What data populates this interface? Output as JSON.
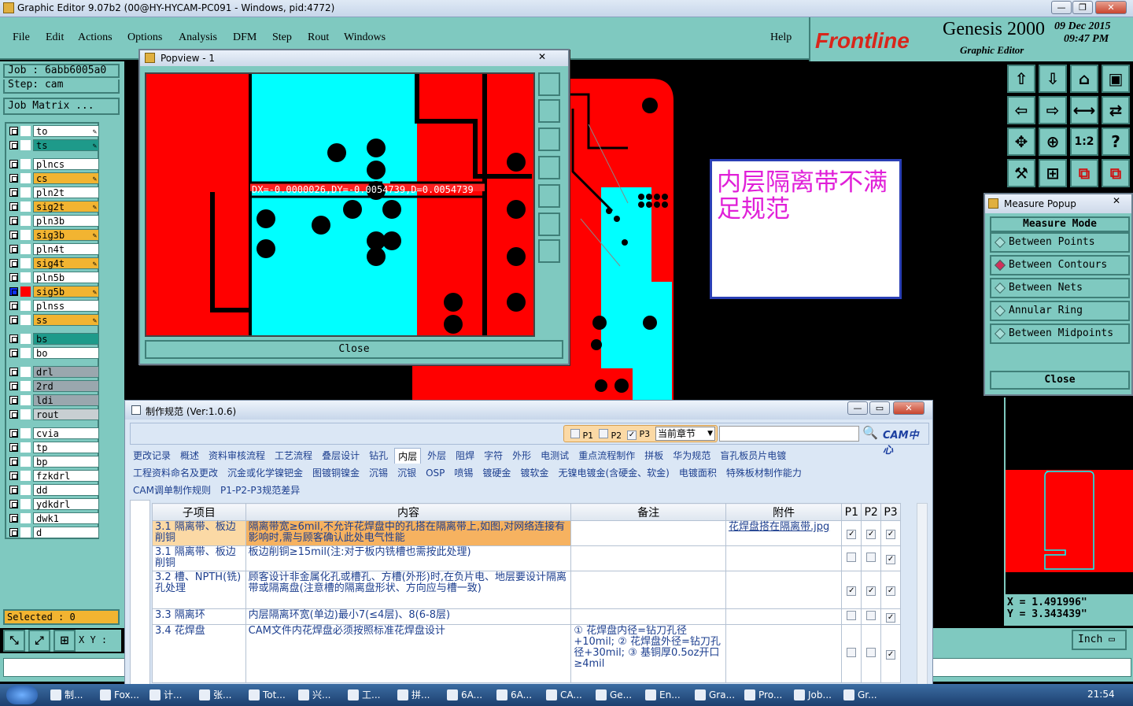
{
  "window": {
    "title": "Graphic Editor 9.07b2 (00@HY-HYCAM-PC091 - Windows, pid:4772)"
  },
  "menu": {
    "items": [
      "File",
      "Edit",
      "Actions",
      "Options",
      "Analysis",
      "DFM",
      "Step",
      "Rout",
      "Windows"
    ],
    "help": "Help"
  },
  "brand": {
    "logo": "Frontline",
    "product": "Genesis 2000",
    "subtitle": "Graphic Editor",
    "date": "09 Dec 2015",
    "time": "09:47 PM"
  },
  "job": {
    "job_label": "Job : 6abb6005a0",
    "step_label": "Step: cam",
    "matrix_button": "Job Matrix ..."
  },
  "layers": [
    {
      "name": "to",
      "color": "#ffffff",
      "pen": true
    },
    {
      "name": "ts",
      "color": "#1e9a8a",
      "pen": true
    },
    {
      "name": "plncs",
      "color": "#ffffff",
      "pen": false
    },
    {
      "name": "cs",
      "color": "#f2b431",
      "pen": true
    },
    {
      "name": "pln2t",
      "color": "#ffffff",
      "pen": false
    },
    {
      "name": "sig2t",
      "color": "#f2b431",
      "pen": true
    },
    {
      "name": "pln3b",
      "color": "#ffffff",
      "pen": false
    },
    {
      "name": "sig3b",
      "color": "#f2b431",
      "pen": true
    },
    {
      "name": "pln4t",
      "color": "#ffffff",
      "pen": false
    },
    {
      "name": "sig4t",
      "color": "#f2b431",
      "pen": true
    },
    {
      "name": "pln5b",
      "color": "#ffffff",
      "pen": false
    },
    {
      "name": "sig5b",
      "color": "#f2b431",
      "pen": true
    },
    {
      "name": "plnss",
      "color": "#ffffff",
      "pen": false
    },
    {
      "name": "ss",
      "color": "#f2b431",
      "pen": true
    },
    {
      "name": "bs",
      "color": "#1e9a8a",
      "pen": false
    },
    {
      "name": "bo",
      "color": "#ffffff",
      "pen": false
    },
    {
      "name": "drl",
      "color": "#9aa7ae",
      "pen": false
    },
    {
      "name": "2rd",
      "color": "#9aa7ae",
      "pen": false
    },
    {
      "name": "ldi",
      "color": "#9aa7ae",
      "pen": false
    },
    {
      "name": "rout",
      "color": "#c8cfd2",
      "pen": false
    },
    {
      "name": "cvia",
      "color": "#ffffff",
      "pen": false
    },
    {
      "name": "tp",
      "color": "#ffffff",
      "pen": false
    },
    {
      "name": "bp",
      "color": "#ffffff",
      "pen": false
    },
    {
      "name": "fzkdrl",
      "color": "#ffffff",
      "pen": false
    },
    {
      "name": "dd",
      "color": "#ffffff",
      "pen": false
    },
    {
      "name": "ydkdrl",
      "color": "#ffffff",
      "pen": false
    },
    {
      "name": "dwk1",
      "color": "#ffffff",
      "pen": false
    },
    {
      "name": "d",
      "color": "#ffffff",
      "pen": false
    }
  ],
  "selected": "Selected : 0",
  "xy_label": "X Y :",
  "popview": {
    "title": "Popview - 1",
    "measure_text": "DX=-0.0000026,DY=-0.0054739,D=0.0054739",
    "close": "Close"
  },
  "message": {
    "text": "内层隔离带不满足规范"
  },
  "measure_popup": {
    "title": "Measure Popup",
    "header": "Measure Mode",
    "options": [
      "Between Points",
      "Between Contours",
      "Between Nets",
      "Annular Ring",
      "Between Midpoints"
    ],
    "selected_index": 1,
    "close": "Close"
  },
  "coords": {
    "x": "X = 1.491996\"",
    "y": "Y = 3.343439\"",
    "units": "Inch"
  },
  "spec": {
    "title": "制作规范 (Ver:1.0.6)",
    "filters": [
      "P1",
      "P2",
      "P3"
    ],
    "chapter_select": "当前章节",
    "search_placeholder": "",
    "brand": "CAM中心",
    "tabs_row1": [
      "更改记录",
      "概述",
      "资料审核流程",
      "工艺流程",
      "叠层设计",
      "钻孔",
      "内层",
      "外层",
      "阻焊",
      "字符",
      "外形",
      "电测试",
      "重点流程制作",
      "拼板",
      "华为规范",
      "盲孔板员片电镀"
    ],
    "tabs_row2": [
      "工程资料命名及更改",
      "沉金或化学镍钯金",
      "图镀铜镍金",
      "沉锡",
      "沉银",
      "OSP",
      "喷锡",
      "镀硬金",
      "镀软金",
      "无镍电镀金(含硬金、软金)",
      "电镀面积",
      "特殊板材制作能力"
    ],
    "tabs_row3": [
      "CAM调单制作规则",
      "P1-P2-P3规范差异"
    ],
    "active_tab": "内层",
    "columns": [
      "子项目",
      "内容",
      "备注",
      "附件",
      "P1",
      "P2",
      "P3"
    ],
    "rows": [
      {
        "item": "3.1 隔离带、板边削铜",
        "content": "隔离带宽≥6mil,不允许花焊盘中的孔搭在隔离带上,如图,对网络连接有影响时,需与顾客确认此处电气性能",
        "note": "",
        "attach": "花焊盘搭在隔离带.jpg",
        "p": [
          "✓",
          "✓",
          "✓"
        ]
      },
      {
        "item": "3.1 隔离带、板边削铜",
        "content": "板边削铜≥15mil(注:对于板内铣槽也需按此处理)",
        "note": "",
        "attach": "",
        "p": [
          "",
          "",
          "✓"
        ]
      },
      {
        "item": "3.2 槽、NPTH(铣)孔处理",
        "content": "顾客设计非金属化孔或槽孔、方槽(外形)时,在负片电、地层要设计隔离带或隔离盘(注意槽的隔离盘形状、方向应与槽一致)",
        "note": "",
        "attach": "",
        "p": [
          "✓",
          "✓",
          "✓"
        ]
      },
      {
        "item": "3.3 隔离环",
        "content": "内层隔离环宽(单边)最小7(≤4层)、8(6-8层)",
        "note": "",
        "attach": "",
        "p": [
          "",
          "",
          "✓"
        ]
      },
      {
        "item": "3.4 花焊盘",
        "content": "CAM文件内花焊盘必须按照标准花焊盘设计",
        "note": "① 花焊盘内径=钻刀孔径+10mil; ② 花焊盘外径=钻刀孔径+30mil; ③ 基铜厚0.5oz开口≥4mil",
        "attach": "",
        "p": [
          "",
          "",
          "✓"
        ]
      }
    ]
  },
  "taskbar": {
    "items": [
      "制...",
      "Fox...",
      "计...",
      "张...",
      "Tot...",
      "兴...",
      "工...",
      "拼...",
      "6A...",
      "6A...",
      "CA...",
      "Ge...",
      "En...",
      "Gra...",
      "Pro...",
      "Job...",
      "Gr..."
    ],
    "clock": "21:54"
  }
}
